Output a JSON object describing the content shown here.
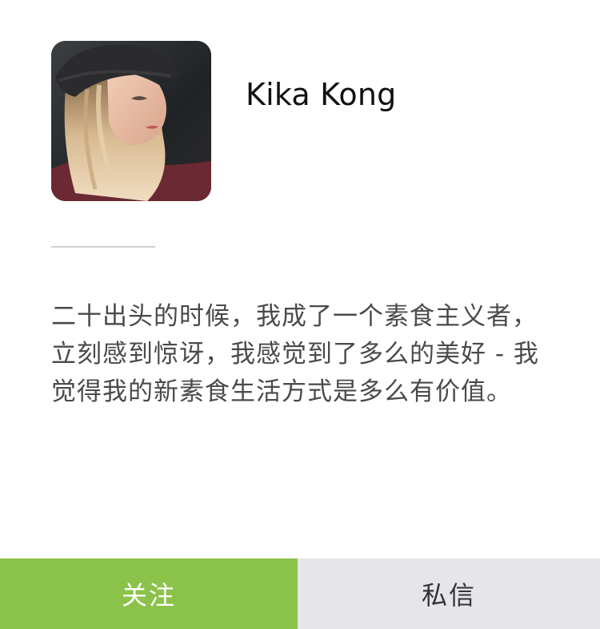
{
  "profile": {
    "name": "Kika Kong",
    "avatar_alt": "Kika Kong"
  },
  "bio": {
    "lines": [
      "二十出头的时候，我成了一个素食主义者，",
      "立刻感到惊讶，我感觉到了多么的美好 - 我",
      "觉得我的新素食生活方式是多么有价值。"
    ]
  },
  "actions": {
    "follow_label": "关注",
    "message_label": "私信"
  },
  "colors": {
    "follow_bg": "#8bc34a",
    "message_bg": "#e6e5e9",
    "divider": "#cfcfcf"
  }
}
